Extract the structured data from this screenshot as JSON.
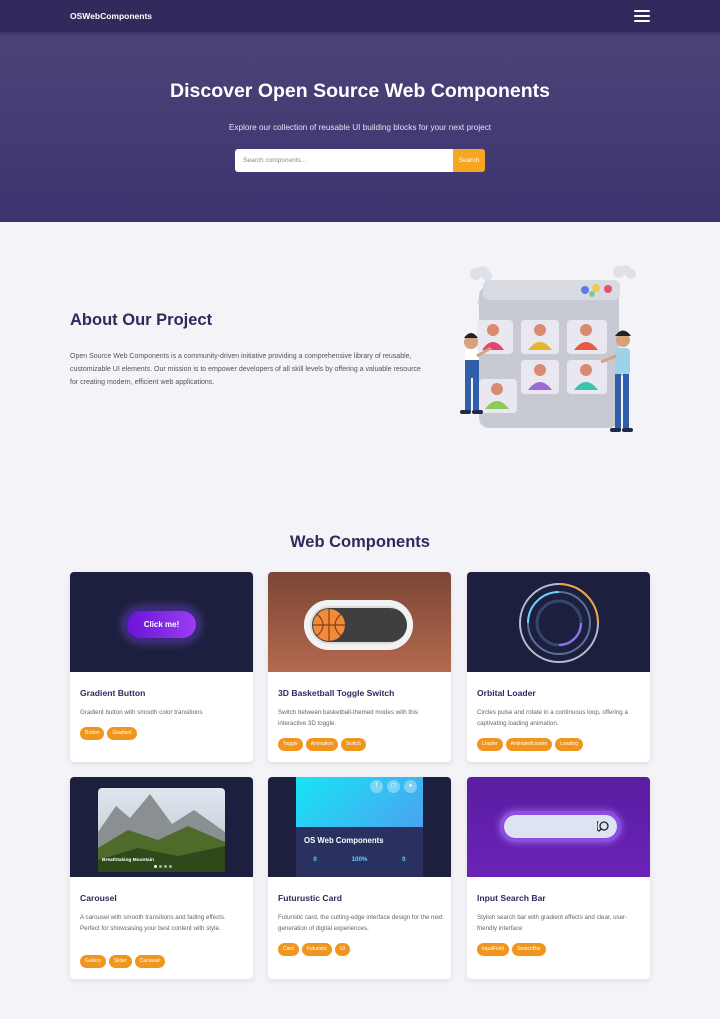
{
  "nav": {
    "brand": "OSWebComponents",
    "menu_icon": "hamburger-menu-icon"
  },
  "hero": {
    "title": "Discover Open Source Web Components",
    "subtitle": "Explore our collection of reusable UI building blocks for your next project",
    "search_placeholder": "Search components...",
    "search_value": "",
    "search_button": "Search"
  },
  "about": {
    "title": "About Our Project",
    "text": "Open Source Web Components is a community-driven initiative providing a comprehensive library of reusable, customizable UI elements. Our mission is to empower developers of all skill levels by offering a valuable resource for creating modern, efficient web applications."
  },
  "components": {
    "title": "Web Components",
    "cards": [
      {
        "title": "Gradient Button",
        "description": "Gradient button with smooth color transitions",
        "tags": [
          "Button",
          "Gradient"
        ],
        "preview_label": "Click me!"
      },
      {
        "title": "3D Basketball Toggle Switch",
        "description": "Switch between basketball-themed modes with this interactive 3D toggle.",
        "tags": [
          "Toggle",
          "Animation",
          "Switch"
        ]
      },
      {
        "title": "Orbital Loader",
        "description": "Circles pulse and rotate in a continuous loop, offering a captivating loading animation.",
        "tags": [
          "Loader",
          "AnimatedLoader",
          "Loading"
        ]
      },
      {
        "title": "Carousel",
        "description": "A carousel with smooth transitions and fading effects. Perfect for showcasing your best content with style.",
        "tags": [
          "Gallery",
          "Slider",
          "Carousel"
        ],
        "preview_caption": "Breathtaking Mountain"
      },
      {
        "title": "Futurustic Card",
        "description": "Futuristic card, the cutting-edge interface design for the next generation of digital experiences.",
        "tags": [
          "Card",
          "Futuristic",
          "UI"
        ],
        "preview_title": "OS Web Components",
        "preview_stats": [
          "0",
          "100%",
          "0"
        ]
      },
      {
        "title": "Input Search Bar",
        "description": "Stylish search bar with gradient effects and clear, user-friendly interface",
        "tags": [
          "InputField",
          "SearchBar"
        ]
      }
    ]
  },
  "colors": {
    "nav": "#312b5d",
    "hero": "#443d74",
    "accent": "#f5a623",
    "heading": "#2f2a5c",
    "page": "#f4f3f7"
  }
}
